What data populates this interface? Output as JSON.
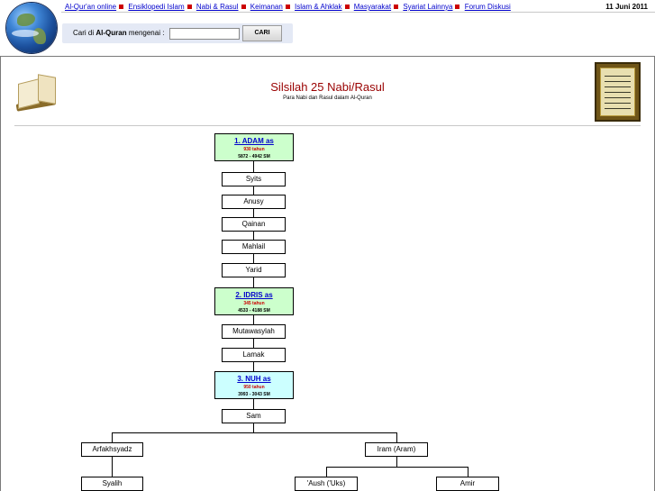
{
  "nav": {
    "links": [
      "Al-Qur'an online",
      "Ensiklopedi Islam",
      "Nabi & Rasul",
      "Keimanan",
      "Islam & Ahklak",
      "Masyarakat",
      "Syariat Lainnya",
      "Forum Diskusi"
    ],
    "date": "11 Juni 2011"
  },
  "search": {
    "label_prefix": "Cari di",
    "label_bold": "Al-Quran",
    "label_suffix": "mengenai :",
    "input_value": "",
    "button_label": "CARI"
  },
  "header": {
    "title": "Silsilah 25 Nabi/Rasul",
    "subtitle": "Para Nabi dan Rasul dalam Al-Quran"
  },
  "tree": {
    "adam": {
      "name": "1. ADAM as",
      "age": "930 tahun",
      "years": "5872 - 4942 SM"
    },
    "syits": "Syits",
    "anusy": "Anusy",
    "qainan": "Qainan",
    "mahlail": "Mahlail",
    "yarid": "Yarid",
    "idris": {
      "name": "2. IDRIS as",
      "age": "345 tahun",
      "years": "4533 - 4188 SM"
    },
    "mutawasylah": "Mutawasylah",
    "lamak": "Lamak",
    "nuh": {
      "name": "3. NUH as",
      "age": "950 tahun",
      "years": "3993 - 3043 SM"
    },
    "sam": "Sam",
    "arfakhsyadz": "Arfakhsyadz",
    "iram": "Iram (Aram)",
    "syalih": "Syalih",
    "aush": "'Aush ('Uks)",
    "amir": "Amir"
  },
  "colors": {
    "link": "#0000cc",
    "title": "#990000",
    "adam_bg": "#ccffcc",
    "idris_bg": "#ccffcc",
    "nuh_bg": "#ccffff",
    "nav_bullet": "#cc0000"
  }
}
